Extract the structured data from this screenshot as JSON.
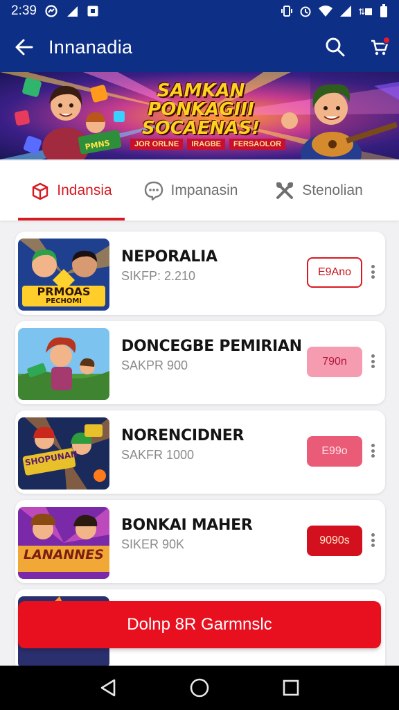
{
  "status_bar": {
    "time": "2:39",
    "left_icons": [
      "messenger-icon",
      "signal-icon",
      "notification-icon"
    ],
    "right_icons": [
      "vibrate-icon",
      "alarm-icon",
      "wifi-icon",
      "cell-signal-icon",
      "battery-icon"
    ]
  },
  "app_bar": {
    "title": "Innanadia",
    "back_icon": "back-arrow-icon",
    "search_icon": "search-icon",
    "cart_icon": "cart-icon",
    "background": "#0d2f86"
  },
  "banner": {
    "headline_lines": [
      "SAMKAN",
      "PONKAGIII",
      "SOCAENAS!"
    ],
    "tags": [
      "JOR ORLNE",
      "IRAGBE",
      "FERSAOLOR"
    ]
  },
  "tabs": [
    {
      "label": "Indansia",
      "icon": "box-icon",
      "active": true
    },
    {
      "label": "Impanasin",
      "icon": "chat-icon",
      "active": false
    },
    {
      "label": "Stenolian",
      "icon": "tools-icon",
      "active": false
    }
  ],
  "items": [
    {
      "name": "NEPORALIA",
      "sub": "SIKFP: 2.210",
      "price": "E9Ano",
      "price_style": "outline",
      "thumb_text": "PRMOAS",
      "thumb_sub": "PECHOMI"
    },
    {
      "name": "DONCEGBE PEMIRIAN",
      "sub": "SAKPR 900",
      "price": "790n",
      "price_style": "soft",
      "thumb_text": "",
      "thumb_sub": ""
    },
    {
      "name": "NORENCIDNER",
      "sub": "SAKFR 1000",
      "price": "E99o",
      "price_style": "mid",
      "thumb_text": "SHOPUNAN",
      "thumb_sub": ""
    },
    {
      "name": "BONKAI MAHER",
      "sub": "SIKER 90K",
      "price": "9090s",
      "price_style": "solid",
      "thumb_text": "LANANNES",
      "thumb_sub": ""
    }
  ],
  "cta": {
    "label": "Dolnp 8R Garmnslc",
    "color": "#e8101f"
  },
  "accent": "#d71a21",
  "nav_bar": [
    "nav-back-icon",
    "nav-home-icon",
    "nav-recents-icon"
  ]
}
